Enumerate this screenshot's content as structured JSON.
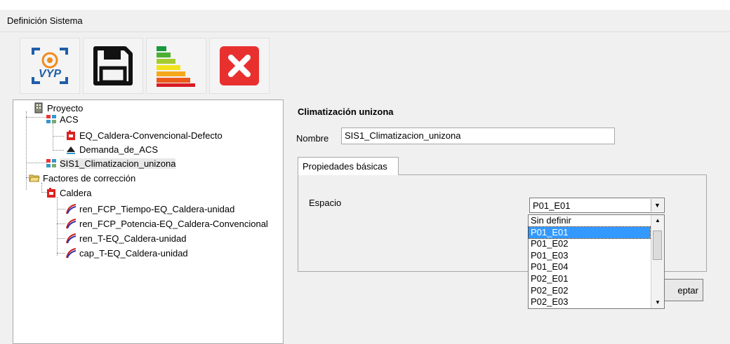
{
  "window": {
    "title": "Definición Sistema"
  },
  "toolbar": {
    "logo_text": "VYP",
    "buttons": [
      {
        "name": "vyp-logo-button",
        "icon": "vyp-logo-icon"
      },
      {
        "name": "save-button",
        "icon": "floppy-disk-icon"
      },
      {
        "name": "energy-rating-button",
        "icon": "energy-rating-icon"
      },
      {
        "name": "close-button",
        "icon": "close-icon"
      }
    ]
  },
  "tree": {
    "proyecto": "Proyecto",
    "acs": "ACS",
    "eq_caldera": "EQ_Caldera-Convencional-Defecto",
    "demanda": "Demanda_de_ACS",
    "sis1": "SIS1_Climatizacion_unizona",
    "factores": "Factores de corrección",
    "caldera": "Caldera",
    "curves": [
      "ren_FCP_Tiempo-EQ_Caldera-unidad",
      "ren_FCP_Potencia-EQ_Caldera-Convencional",
      "ren_T-EQ_Caldera-unidad",
      "cap_T-EQ_Caldera-unidad"
    ]
  },
  "panel": {
    "title": "Climatización unizona",
    "name_label": "Nombre",
    "name_value": "SIS1_Climatizacion_unizona",
    "tab_label": "Propiedades básicas",
    "espacio_label": "Espacio",
    "espacio_selected": "P01_E01",
    "accept_label": "eptar",
    "options": [
      "Sin definir",
      "P01_E01",
      "P01_E02",
      "P01_E03",
      "P01_E04",
      "P02_E01",
      "P02_E02",
      "P02_E03"
    ]
  },
  "colors": {
    "highlight": "#3399ff",
    "close_red": "#e8312f",
    "logo_blue": "#1f5ea8",
    "logo_orange": "#f28a1c"
  }
}
